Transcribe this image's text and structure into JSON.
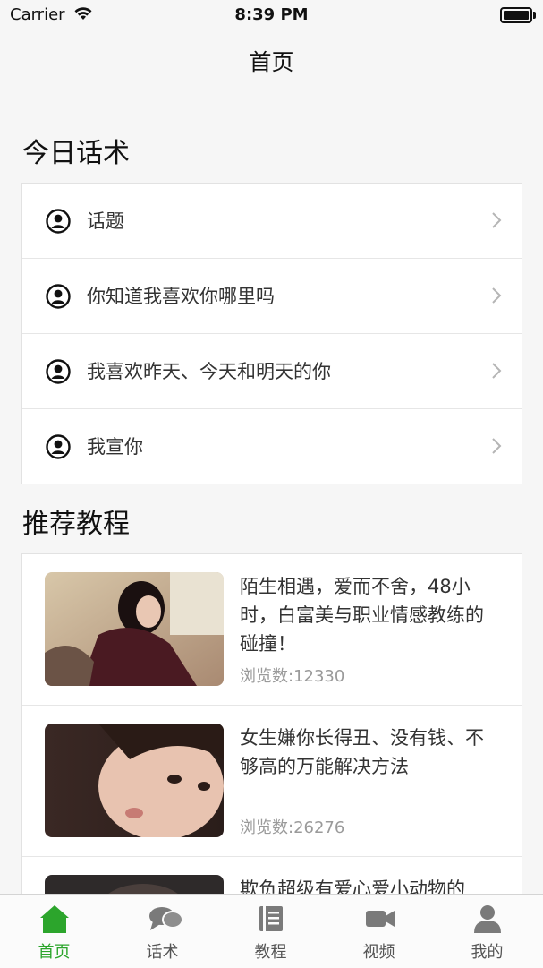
{
  "status_bar": {
    "carrier": "Carrier",
    "time": "8:39 PM"
  },
  "nav": {
    "title": "首页"
  },
  "talk_section": {
    "title": "今日话术",
    "items": [
      {
        "label": "话题",
        "icon": "user-circle-icon"
      },
      {
        "label": "你知道我喜欢你哪里吗",
        "icon": "user-circle-icon"
      },
      {
        "label": "我喜欢昨天、今天和明天的你",
        "icon": "user-circle-icon"
      },
      {
        "label": "我宣你",
        "icon": "user-circle-icon"
      }
    ]
  },
  "course_section": {
    "title": "推荐教程",
    "items": [
      {
        "title": "陌生相遇，爱而不舍，48小时，白富美与职业情感教练的碰撞！",
        "views": "浏览数:12330"
      },
      {
        "title": "女生嫌你长得丑、没有钱、不够高的万能解决方法",
        "views": "浏览数:26276"
      },
      {
        "title": "欺负超级有爱心爱小动物的",
        "views": ""
      }
    ]
  },
  "tabbar": {
    "active_color": "#2ca52c",
    "items": [
      {
        "label": "首页",
        "icon": "home-icon",
        "active": true
      },
      {
        "label": "话术",
        "icon": "chat-icon",
        "active": false
      },
      {
        "label": "教程",
        "icon": "book-icon",
        "active": false
      },
      {
        "label": "视频",
        "icon": "video-icon",
        "active": false
      },
      {
        "label": "我的",
        "icon": "person-icon",
        "active": false
      }
    ]
  }
}
